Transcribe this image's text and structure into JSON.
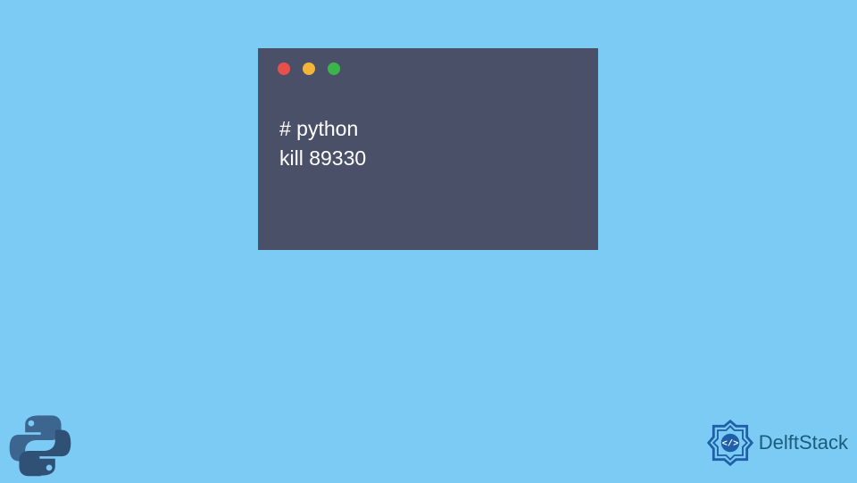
{
  "terminal": {
    "line1": "# python",
    "line2": "kill 89330"
  },
  "brand": {
    "text": "DelftStack"
  },
  "colors": {
    "background": "#7bcbf5",
    "terminal_bg": "#4a5068",
    "traffic_red": "#e9504c",
    "traffic_yellow": "#f2b537",
    "traffic_green": "#3bb54a"
  }
}
